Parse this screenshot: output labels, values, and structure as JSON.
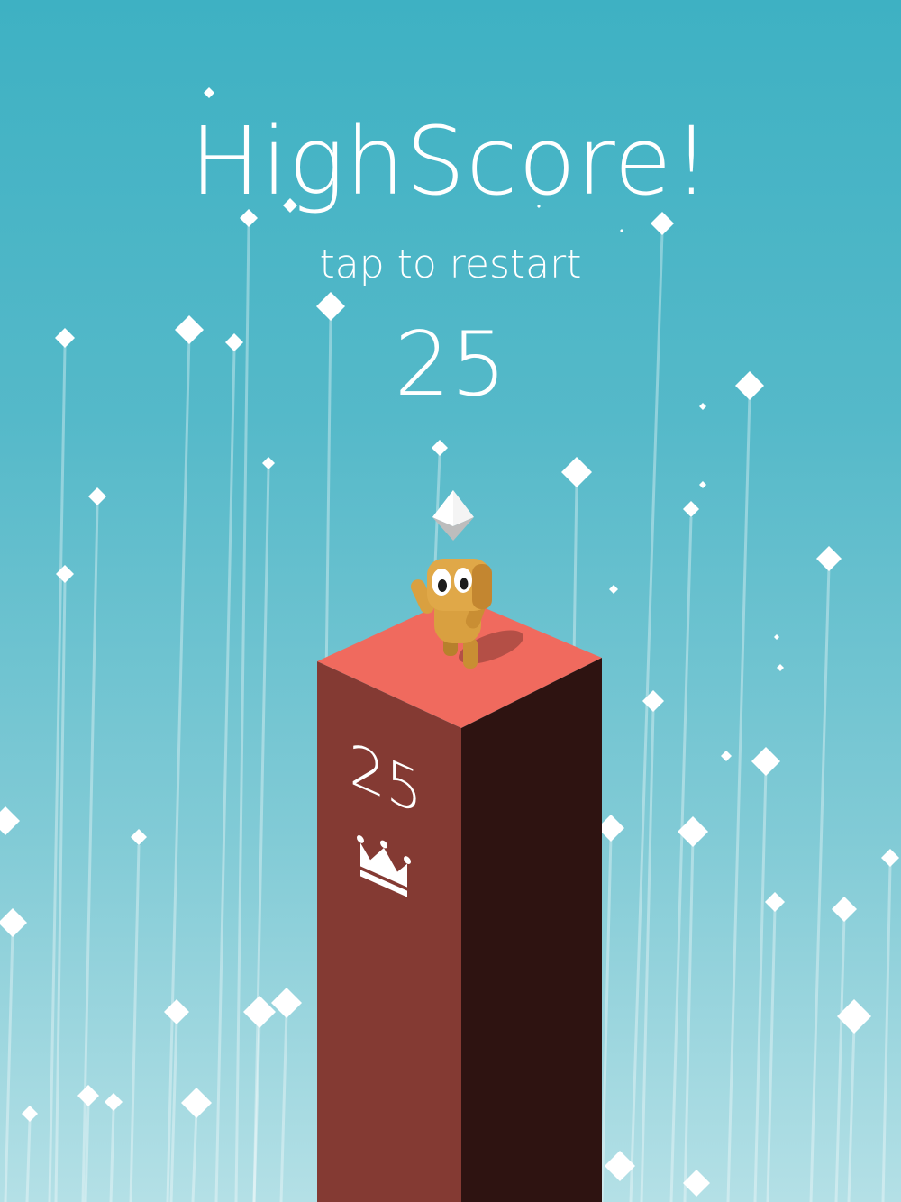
{
  "hud": {
    "title": "HighScore!",
    "subtitle": "tap to restart",
    "score": "25"
  },
  "pillar": {
    "score": "25",
    "badge_icon": "crown-icon"
  },
  "colors": {
    "sky_top": "#3eb1c3",
    "sky_bottom": "#b4e0e6",
    "pillar_top": "#f06a5e",
    "pillar_left": "#843a33",
    "pillar_right": "#2e1311",
    "character": "#d9a040",
    "gem": "#ffffff"
  }
}
